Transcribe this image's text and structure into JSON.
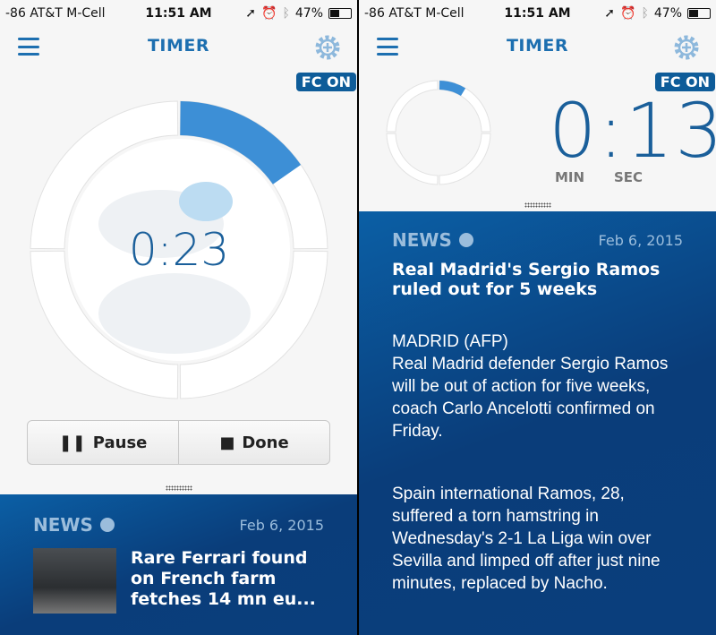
{
  "status_bar": {
    "carrier": "-86 AT&T M-Cell",
    "time": "11:51 AM",
    "battery": "47%",
    "battery_level": 0.47
  },
  "header": {
    "title": "TIMER",
    "fc_badge": "FC ON"
  },
  "left": {
    "timer": "0:23",
    "progress": 0.153,
    "pause_label": "Pause",
    "done_label": "Done",
    "news": {
      "label": "NEWS",
      "date": "Feb 6, 2015",
      "headline": "Rare Ferrari found on French farm fetches 14 mn eu..."
    }
  },
  "right": {
    "timer": "0:13",
    "min_label": "MIN",
    "sec_label": "SEC",
    "progress": 0.087,
    "news": {
      "label": "NEWS",
      "date": "Feb 6, 2015",
      "headline": "Real Madrid's Sergio Ramos ruled out for 5 weeks",
      "paragraphs": [
        "MADRID (AFP)\nReal Madrid defender Sergio Ramos will be out of action for five weeks, coach Carlo Ancelotti confirmed on Friday.",
        "Spain international Ramos, 28, suffered a torn hamstring in Wednesday's 2-1 La Liga win over Sevilla and limped off after just nine minutes, replaced by Nacho."
      ]
    }
  },
  "colors": {
    "accent": "#1d6fb0",
    "badge": "#0e5c99",
    "news_bg": "#0a4a8c",
    "progress": "#3d8fd6"
  }
}
